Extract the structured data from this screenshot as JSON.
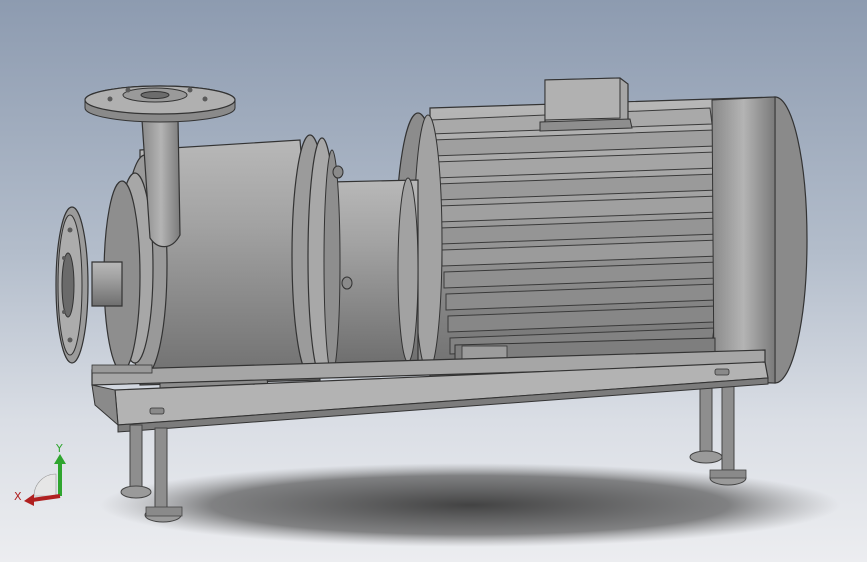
{
  "viewport": {
    "background_top": "#8d9bb0",
    "background_bottom": "#ecedf0"
  },
  "model": {
    "body_color": "#9a9a9a",
    "dark_color": "#5e5e5e",
    "light_color": "#c2c2c2"
  },
  "triad": {
    "y_label": "Y",
    "x_label": "X",
    "y_color": "#2fa52f",
    "x_color": "#b02020",
    "z_color": "#7a7a7a"
  }
}
